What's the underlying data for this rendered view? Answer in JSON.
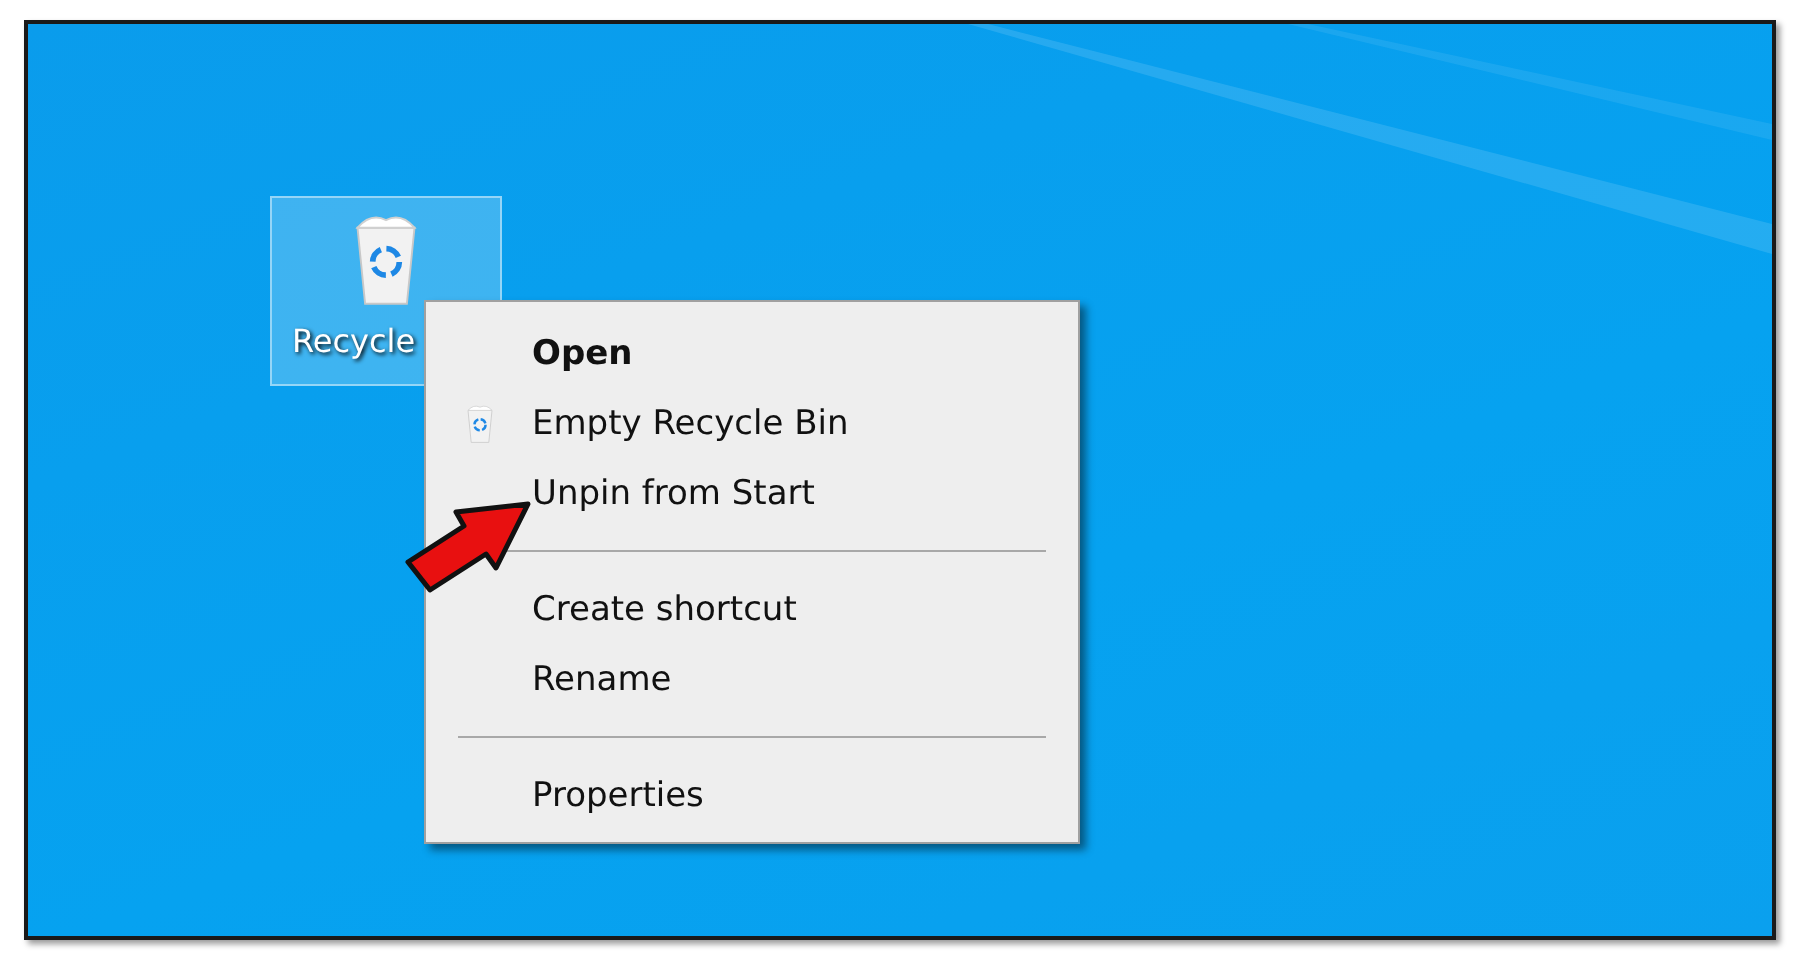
{
  "desktop_icon": {
    "label": "Recycle",
    "selected": true
  },
  "context_menu": {
    "items": [
      {
        "kind": "default",
        "label": "Open"
      },
      {
        "kind": "icon",
        "label": "Empty Recycle Bin"
      },
      {
        "kind": "plain",
        "label": "Unpin from Start"
      },
      {
        "kind": "separator"
      },
      {
        "kind": "plain",
        "label": "Create shortcut"
      },
      {
        "kind": "plain",
        "label": "Rename"
      },
      {
        "kind": "separator"
      },
      {
        "kind": "plain",
        "label": "Properties"
      }
    ]
  }
}
